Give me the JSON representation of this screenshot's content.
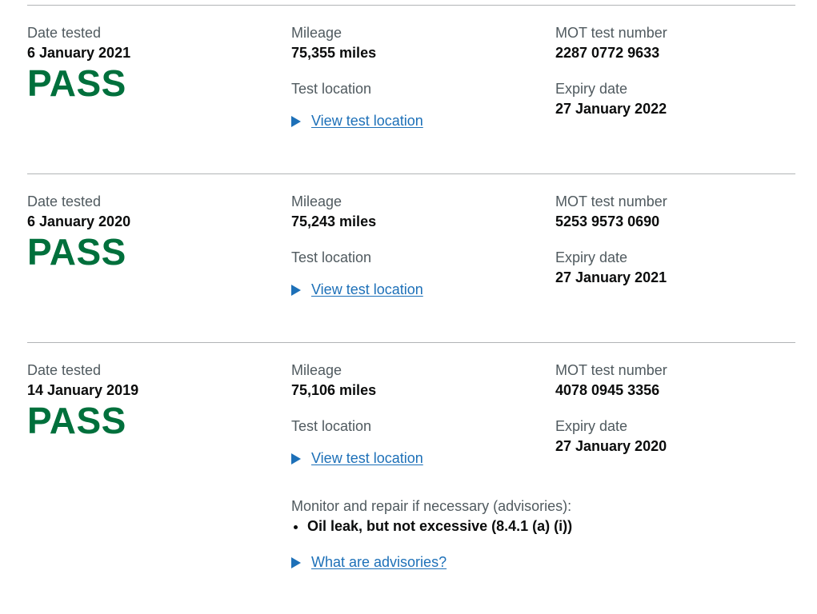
{
  "labels": {
    "date_tested": "Date tested",
    "mileage": "Mileage",
    "test_location": "Test location",
    "view_test_location": "View test location",
    "mot_test_number": "MOT test number",
    "expiry_date": "Expiry date"
  },
  "records": [
    {
      "date": "6 January 2021",
      "result": "PASS",
      "mileage": "75,355 miles",
      "test_number": "2287 0772 9633",
      "expiry": "27 January 2022"
    },
    {
      "date": "6 January 2020",
      "result": "PASS",
      "mileage": "75,243 miles",
      "test_number": "5253 9573 0690",
      "expiry": "27 January 2021"
    },
    {
      "date": "14 January 2019",
      "result": "PASS",
      "mileage": "75,106 miles",
      "test_number": "4078 0945 3356",
      "expiry": "27 January 2020",
      "advisories_heading": "Monitor and repair if necessary (advisories):",
      "advisories": [
        "Oil leak, but not excessive (8.4.1 (a) (i))"
      ],
      "advisories_link": "What are advisories?"
    }
  ],
  "colors": {
    "pass_green": "#00703c",
    "link_blue": "#1d70b8",
    "text": "#0b0c0c",
    "secondary_text": "#505a5f",
    "divider": "#b1b4b6"
  }
}
